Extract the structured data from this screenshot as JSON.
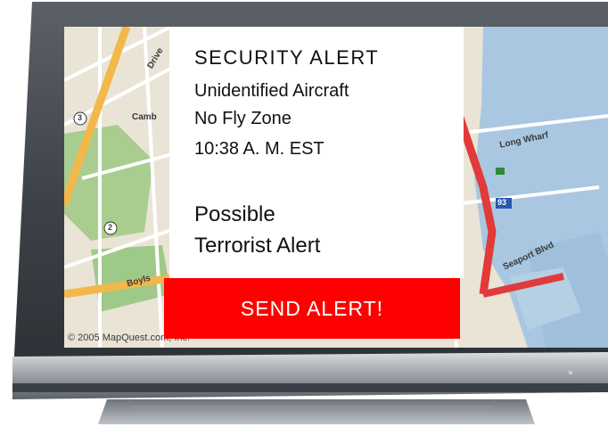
{
  "alert": {
    "title": "SECURITY ALERT",
    "lines": [
      "Unidentified Aircraft",
      "No Fly Zone",
      "10:38 A. M. EST"
    ],
    "warning": [
      "Possible",
      "Terrorist Alert"
    ]
  },
  "button": {
    "label": "SEND ALERT!"
  },
  "map": {
    "copyright": "© 2005 MapQuest.com, Inc.",
    "streets": [
      "Camb",
      "Long Wharf",
      "Seaport Blvd",
      "Boyls",
      "Drive"
    ],
    "route_shields": [
      "3",
      "2",
      "93"
    ]
  },
  "colors": {
    "alert_button": "#ff0000",
    "panel": "#ffffff"
  }
}
